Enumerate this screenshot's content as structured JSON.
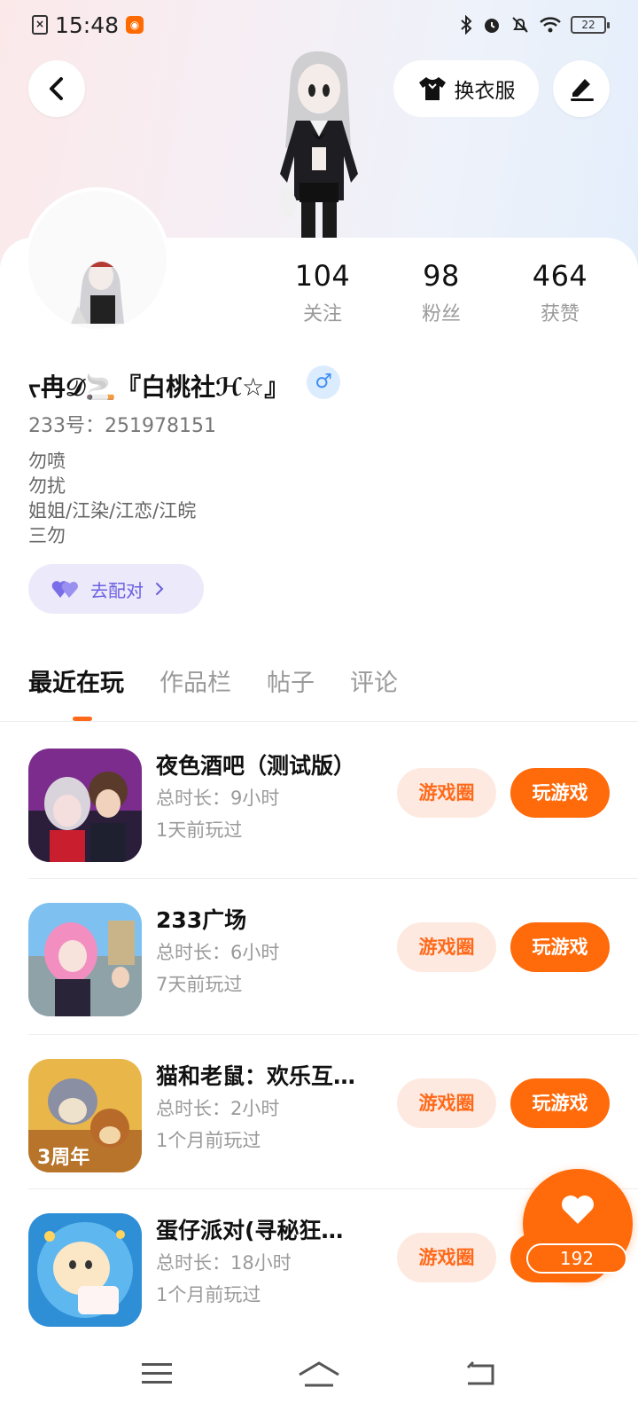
{
  "status_bar": {
    "time": "15:48",
    "battery": "22"
  },
  "header": {
    "dress_button_label": "换衣服"
  },
  "profile": {
    "stats": [
      {
        "num": "104",
        "label": "关注"
      },
      {
        "num": "98",
        "label": "粉丝"
      },
      {
        "num": "464",
        "label": "获赞"
      }
    ],
    "username": "ᡕ冉𝒟🚬『白桃社ℋ☆』",
    "gender_symbol": "♂",
    "uid": "233号：251978151",
    "bio_lines": [
      "勿喷",
      "勿扰",
      "姐姐/江染/江恋/江皖",
      "三勿"
    ],
    "pair_button_label": "去配对"
  },
  "tabs": [
    "最近在玩",
    "作品栏",
    "帖子",
    "评论"
  ],
  "games": [
    {
      "name": "夜色酒吧（测试版）",
      "duration": "总时长：9小时",
      "last_played": "1天前玩过",
      "circle_label": "游戏圈",
      "play_label": "玩游戏"
    },
    {
      "name": "233广场",
      "duration": "总时长：6小时",
      "last_played": "7天前玩过",
      "circle_label": "游戏圈",
      "play_label": "玩游戏"
    },
    {
      "name": "猫和老鼠：欢乐互…",
      "duration": "总时长：2小时",
      "last_played": "1个月前玩过",
      "circle_label": "游戏圈",
      "play_label": "玩游戏"
    },
    {
      "name": "蛋仔派对(寻秘狂…",
      "duration": "总时长：18小时",
      "last_played": "1个月前玩过",
      "circle_label": "游戏圈",
      "play_label": "玩游戏"
    }
  ],
  "like_fab": {
    "count": "192"
  },
  "colors": {
    "accent": "#ff6a0a",
    "accent_light": "#fde9e0",
    "pair_bg": "#ece9fb",
    "pair_text": "#6a5fe0"
  }
}
